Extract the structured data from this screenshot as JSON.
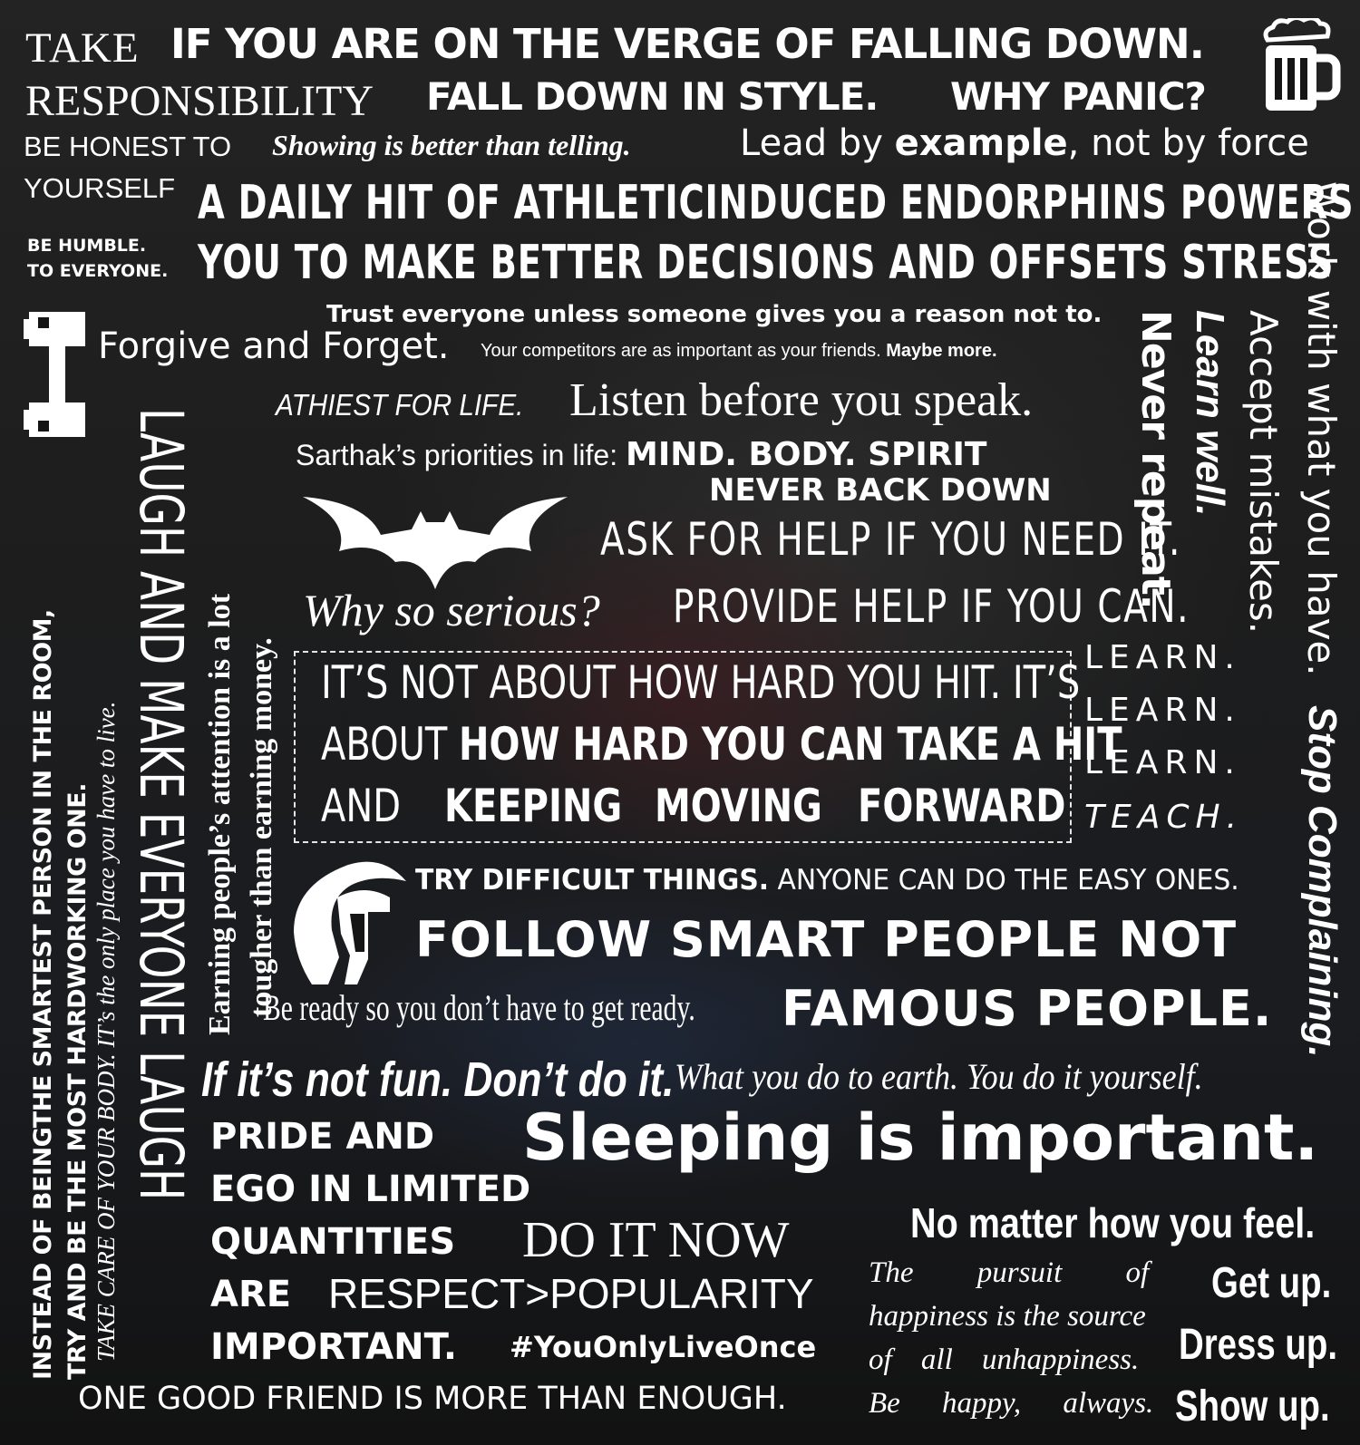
{
  "poster": {
    "take": "TAKE",
    "responsibility": "RESPONSIBILITY",
    "verge": "IF YOU ARE ON THE VERGE OF FALLING DOWN.",
    "fall_style": "FALL DOWN IN STYLE.",
    "why_panic": "WHY PANIC?",
    "be_honest": "BE HONEST TO",
    "yourself": "YOURSELF",
    "showing": "Showing is better than telling.",
    "lead_by": "Lead by ",
    "example": "example",
    "not_by_force": ", not by force",
    "endorphins_1": "A DAILY HIT OF ATHLETICINDUCED ENDORPHINS POWERS",
    "endorphins_2": "YOU TO MAKE BETTER DECISIONS AND OFFSETS STRESS",
    "be_humble": "BE HUMBLE.",
    "to_everyone": "TO EVERYONE.",
    "trust_everyone": "Trust everyone unless someone gives you a reason not to.",
    "forgive": "Forgive and Forget.",
    "competitors": "Your competitors are as important as your friends. ",
    "maybe_more": "Maybe more.",
    "athiest": "ATHIEST FOR LIFE.",
    "listen": "Listen before you speak.",
    "priorities": "Sarthak’s priorities in life: ",
    "mind_body_spirit": "MIND. BODY. SPIRIT",
    "never_back_down": "NEVER BACK DOWN",
    "ask_help": "ASK FOR HELP IF YOU NEED IT.",
    "why_serious": "Why so serious?",
    "provide_help": "PROVIDE HELP IF YOU CAN.",
    "never_repeat": "Never repeat.",
    "learn_well": "Learn well.",
    "accept_mistakes": "Accept mistakes.",
    "work_with": "Work with what you have.",
    "stop_complaining": "Stop Complaining.",
    "learn_1": "LEARN.",
    "learn_2": "LEARN.",
    "learn_3": "LEARN.",
    "teach": "TEACH.",
    "quote_line1": "IT’S NOT ABOUT HOW HARD YOU HIT. IT’S",
    "quote_about": "ABOUT ",
    "quote_hard_hit": "HOW HARD YOU CAN TAKE A HIT",
    "quote_and": "AND",
    "quote_keeping": "KEEPING",
    "quote_moving": "MOVING",
    "quote_forward": "FORWARD",
    "try_difficult": "TRY DIFFICULT THINGS.",
    "anyone_can": " ANYONE CAN DO THE EASY ONES.",
    "follow_smart": "FOLLOW SMART PEOPLE NOT",
    "famous_people": "FAMOUS PEOPLE.",
    "be_ready": "Be ready so you don’t have to get ready.",
    "not_fun": "If it’s not fun. Don’t do it.",
    "earth": "What you do to earth. You do it yourself.",
    "sleeping": "Sleeping is important.",
    "pride_1": "PRIDE AND",
    "pride_2": "EGO IN LIMITED",
    "pride_3": "QUANTITIES",
    "pride_4": "ARE",
    "pride_5": "IMPORTANT.",
    "do_it_now": "DO IT NOW",
    "respect": "RESPECT>POPULARITY",
    "yolo": "#YouOnlyLiveOnce",
    "one_friend": "ONE GOOD FRIEND IS MORE THAN ENOUGH.",
    "no_matter": "No matter how you feel.",
    "get_up": "Get up.",
    "dress_up": "Dress up.",
    "show_up": "Show up.",
    "pursuit_1": "The pursuit of",
    "pursuit_2": "happiness is the source",
    "pursuit_3": "of all unhappiness.",
    "pursuit_4": "Be happy, always.",
    "smartest": "INSTEAD OF BEINGTHE SMARTEST PERSON IN THE ROOM,",
    "hardworking": "TRY AND BE THE MOST HARDWORKING ONE.",
    "body_care": "TAKE CARE OF YOUR BODY. IT’s the only place you have to live.",
    "laugh": "LAUGH AND MAKE EVERYONE LAUGH",
    "earning_1": "Earning people’s attention is a lot",
    "earning_2": "tougher than earning money."
  },
  "icons": [
    "beer-mug-icon",
    "dumbbell-icon",
    "bat-logo-icon",
    "spartan-helmet-icon"
  ]
}
